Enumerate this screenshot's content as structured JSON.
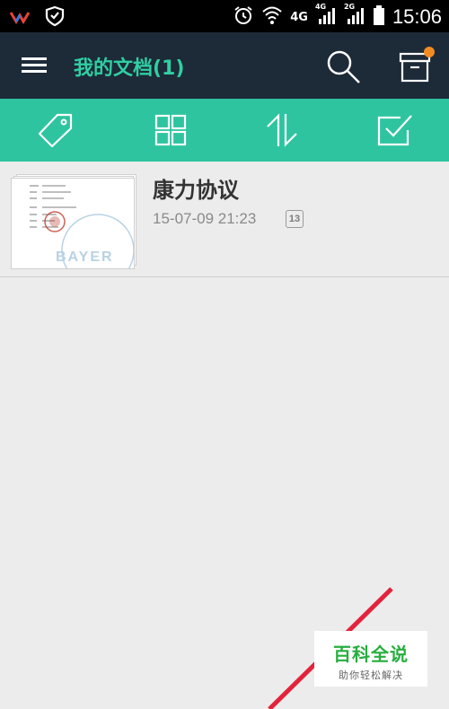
{
  "status_bar": {
    "time": "15:06",
    "network_4g": "4G",
    "network_4g_small": "4G",
    "network_2g_small": "2G",
    "icons": [
      "app-logo-icon",
      "shield-icon",
      "alarm-icon",
      "wifi-icon",
      "signal-icon",
      "battery-icon"
    ]
  },
  "app_bar": {
    "title": "我的文档(1)",
    "icons": [
      "menu-icon",
      "search-icon",
      "archive-icon"
    ],
    "notification_color": "#f28c22"
  },
  "toolbar": {
    "icons": [
      "tag-icon",
      "grid-icon",
      "sort-icon",
      "checkbox-icon"
    ],
    "background": "#2ec4a0"
  },
  "documents": [
    {
      "title": "康力协议",
      "date": "15-07-09 21:23",
      "page_count": "13",
      "thumbnail_text": "BAYER"
    }
  ],
  "watermark": {
    "main": "百科全说",
    "sub": "助你轻松解决"
  },
  "colors": {
    "app_bar": "#1d2a38",
    "accent": "#2fcfa3",
    "background": "#ececec"
  }
}
